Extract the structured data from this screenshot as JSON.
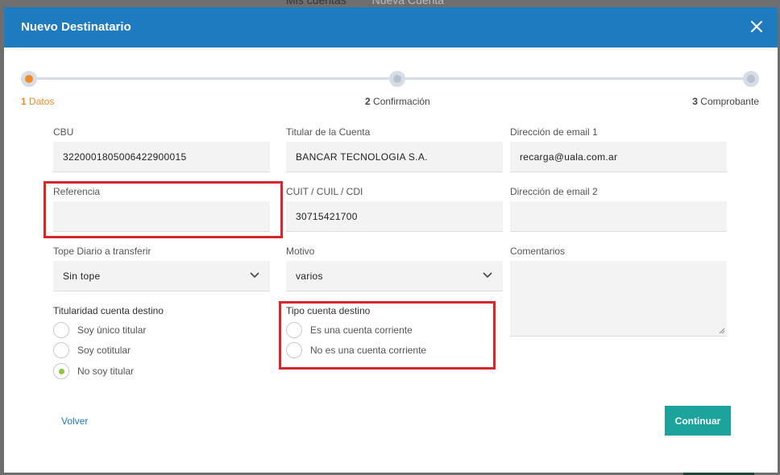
{
  "background": {
    "tab_active": "Mis cuentas",
    "tab_other": "Nueva Cuenta"
  },
  "modal": {
    "title": "Nuevo Destinatario",
    "header_color": "#1f7bc0"
  },
  "stepper": {
    "steps": [
      {
        "number": "1",
        "label": "Datos",
        "state": "active"
      },
      {
        "number": "2",
        "label": "Confirmación",
        "state": "pending"
      },
      {
        "number": "3",
        "label": "Comprobante",
        "state": "pending"
      }
    ],
    "active_color": "#f08a2a"
  },
  "form": {
    "cbu": {
      "label": "CBU",
      "value": "3220001805006422900015"
    },
    "titular": {
      "label": "Titular de la Cuenta",
      "value": "BANCAR TECNOLOGIA S.A."
    },
    "email1": {
      "label": "Dirección de email 1",
      "value": "recarga@uala.com.ar"
    },
    "referencia": {
      "label": "Referencia",
      "value": ""
    },
    "cuit": {
      "label": "CUIT / CUIL / CDI",
      "value": "30715421700"
    },
    "email2": {
      "label": "Dirección de email 2",
      "value": ""
    },
    "tope": {
      "label": "Tope Diario a transferir",
      "value": "Sin tope"
    },
    "motivo": {
      "label": "Motivo",
      "value": "varios"
    },
    "comentarios": {
      "label": "Comentarios",
      "value": ""
    },
    "titularidad": {
      "label": "Titularidad cuenta destino",
      "options": [
        "Soy único titular",
        "Soy cotitular",
        "No soy titular"
      ],
      "selected": "No soy titular"
    },
    "tipo_cuenta": {
      "label": "Tipo cuenta destino",
      "options": [
        "Es una cuenta corriente",
        "No es una cuenta corriente"
      ],
      "selected": null
    }
  },
  "actions": {
    "back_label": "Volver",
    "continue_label": "Continuar",
    "continue_color": "#1ba39c"
  },
  "highlight_color": "#d9262a"
}
